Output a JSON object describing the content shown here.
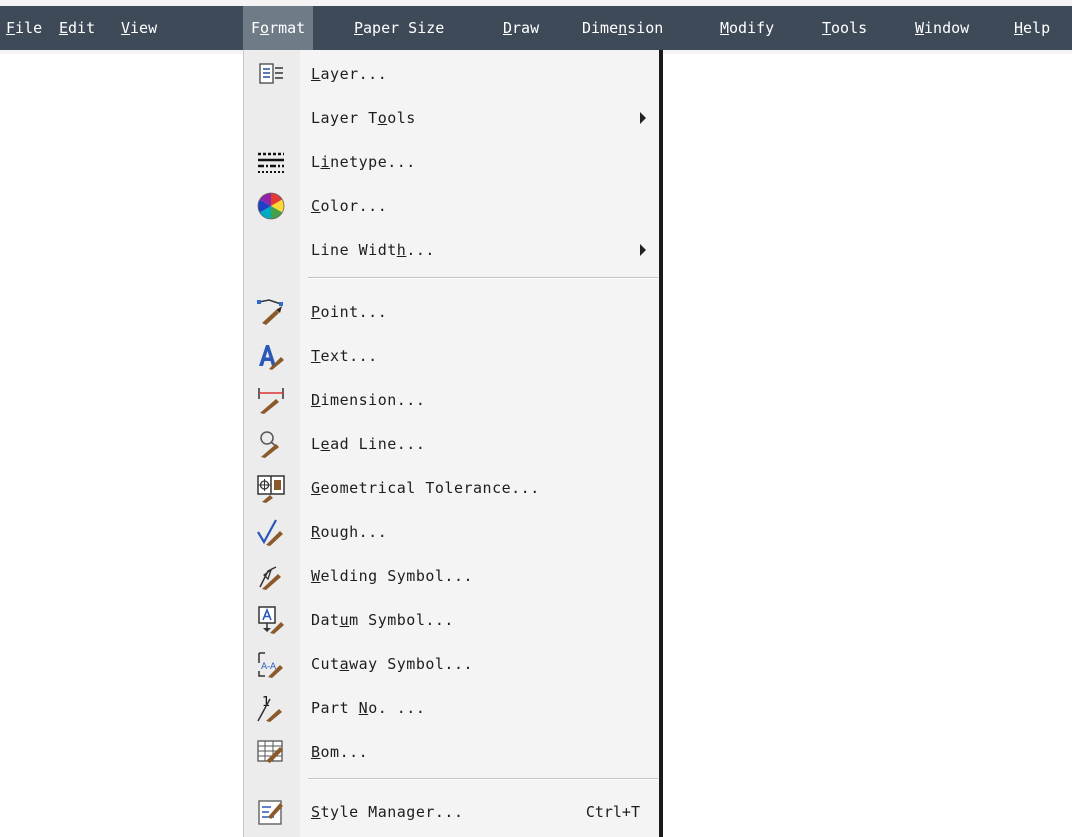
{
  "menubar": {
    "items": [
      {
        "pre": "",
        "acc": "F",
        "post": "ile"
      },
      {
        "pre": "",
        "acc": "E",
        "post": "dit"
      },
      {
        "pre": "",
        "acc": "V",
        "post": "iew"
      },
      {
        "pre": "F",
        "acc": "o",
        "post": "rmat"
      },
      {
        "pre": "",
        "acc": "P",
        "post": "aper Size"
      },
      {
        "pre": "",
        "acc": "D",
        "post": "raw"
      },
      {
        "pre": "Dime",
        "acc": "n",
        "post": "sion"
      },
      {
        "pre": "",
        "acc": "M",
        "post": "odify"
      },
      {
        "pre": "",
        "acc": "T",
        "post": "ools"
      },
      {
        "pre": "",
        "acc": "W",
        "post": "indow"
      },
      {
        "pre": "",
        "acc": "H",
        "post": "elp"
      }
    ]
  },
  "format_menu": {
    "items": [
      {
        "pre": "",
        "acc": "L",
        "post": "ayer...",
        "icon": "layer-icon"
      },
      {
        "pre": "Layer T",
        "acc": "o",
        "post": "ols",
        "icon": "",
        "submenu": true
      },
      {
        "pre": "L",
        "acc": "i",
        "post": "netype...",
        "icon": "linetype-icon"
      },
      {
        "pre": "",
        "acc": "C",
        "post": "olor...",
        "icon": "color-wheel-icon"
      },
      {
        "pre": "Line Widt",
        "acc": "h",
        "post": "...",
        "icon": "",
        "submenu": true
      },
      {
        "pre": "",
        "acc": "P",
        "post": "oint...",
        "icon": "point-style-icon"
      },
      {
        "pre": "",
        "acc": "T",
        "post": "ext...",
        "icon": "text-style-icon"
      },
      {
        "pre": "",
        "acc": "D",
        "post": "imension...",
        "icon": "dimension-style-icon"
      },
      {
        "pre": "L",
        "acc": "e",
        "post": "ad Line...",
        "icon": "lead-line-style-icon"
      },
      {
        "pre": "",
        "acc": "G",
        "post": "eometrical Tolerance...",
        "icon": "geometrical-tolerance-icon"
      },
      {
        "pre": "",
        "acc": "R",
        "post": "ough...",
        "icon": "rough-style-icon"
      },
      {
        "pre": "",
        "acc": "W",
        "post": "elding Symbol...",
        "icon": "welding-symbol-icon"
      },
      {
        "pre": "Dat",
        "acc": "u",
        "post": "m Symbol...",
        "icon": "datum-symbol-icon"
      },
      {
        "pre": "Cut",
        "acc": "a",
        "post": "way Symbol...",
        "icon": "cutaway-symbol-icon"
      },
      {
        "pre": "Part ",
        "acc": "N",
        "post": "o. ...",
        "icon": "part-no-icon"
      },
      {
        "pre": "",
        "acc": "B",
        "post": "om...",
        "icon": "bom-icon"
      },
      {
        "pre": "",
        "acc": "S",
        "post": "tyle Manager...",
        "icon": "style-manager-icon",
        "shortcut": "Ctrl+T"
      }
    ]
  },
  "colors": {
    "menubar_bg": "#3e4a57",
    "active_item_bg": "#6f7b86",
    "menu_bg": "#f4f4f4"
  }
}
